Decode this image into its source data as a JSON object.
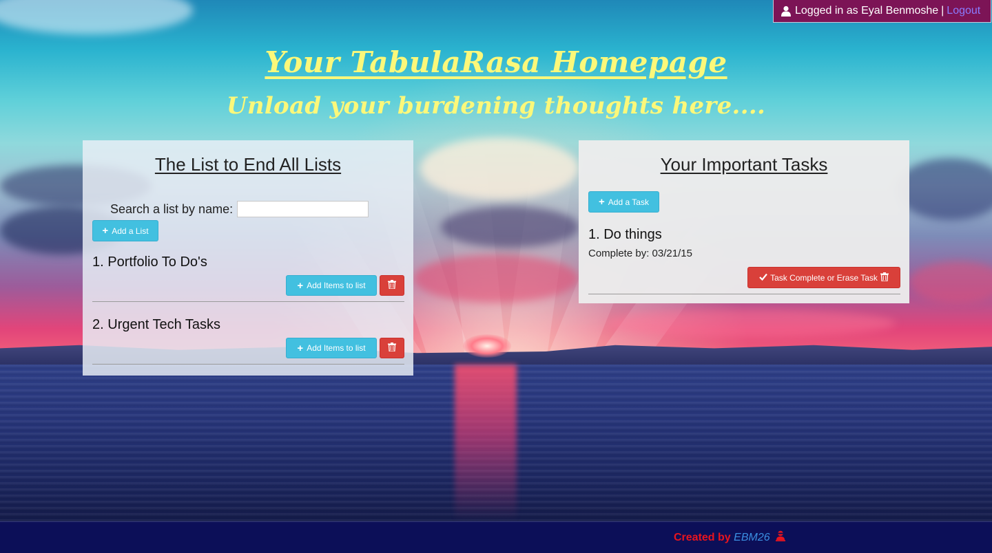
{
  "header": {
    "login_prefix": "Logged in as Eyal Benmoshe",
    "separator": "|",
    "logout_label": "Logout"
  },
  "hero": {
    "title": "Your TabulaRasa Homepage",
    "subtitle": "Unload your burdening thoughts here...."
  },
  "lists_panel": {
    "title": "The List to End All Lists",
    "search_label": "Search a list by name:",
    "search_value": "",
    "search_placeholder": "",
    "add_list_label": "Add a List",
    "items": [
      {
        "title": "1. Portfolio To Do's",
        "add_items_label": "Add Items to list"
      },
      {
        "title": "2. Urgent Tech Tasks",
        "add_items_label": "Add Items to list"
      }
    ]
  },
  "tasks_panel": {
    "title": "Your Important Tasks",
    "add_task_label": "Add a Task",
    "items": [
      {
        "title": "1. Do things",
        "due": "Complete by: 03/21/15",
        "action_label": "Task Complete or Erase Task"
      }
    ]
  },
  "footer": {
    "created_by": "Created by",
    "author": "EBM26"
  },
  "icons": {
    "user": "user-icon",
    "plus": "plus-icon",
    "trash": "trash-icon",
    "check": "check-icon",
    "ninja": "ninja-icon"
  },
  "colors": {
    "login_badge_bg": "#7c1456",
    "hero_text": "#fbf87a",
    "btn_info": "#42c0e0",
    "btn_danger": "#d9403a",
    "footer_bg": "#0c0f58",
    "footer_credit": "#e8141e",
    "footer_author": "#3a8ee0"
  }
}
